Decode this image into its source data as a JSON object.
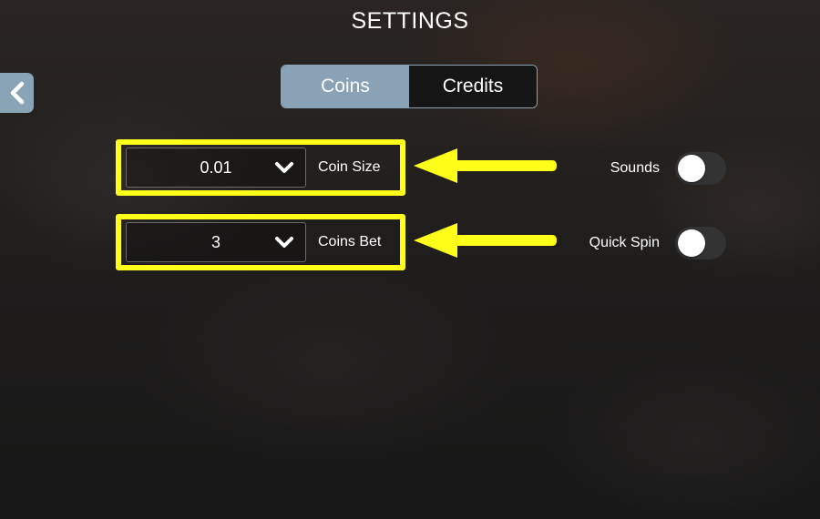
{
  "header": {
    "title": "SETTINGS",
    "back_icon": "chevron-left-icon"
  },
  "tabs": [
    {
      "label": "Coins",
      "active": true
    },
    {
      "label": "Credits",
      "active": false
    }
  ],
  "selects": [
    {
      "label": "Coin Size",
      "value": "0.01",
      "icon": "chevron-down-icon"
    },
    {
      "label": "Coins Bet",
      "value": "3",
      "icon": "chevron-down-icon"
    }
  ],
  "toggles": [
    {
      "label": "Sounds",
      "on": false
    },
    {
      "label": "Quick Spin",
      "on": false
    }
  ],
  "annotations": {
    "highlight_color": "#FFFF1A",
    "arrow_icon": "arrow-left-icon"
  },
  "colors": {
    "accent": "#89A2B5",
    "toggle_track": "#333333",
    "toggle_knob": "#FFFFFF"
  }
}
